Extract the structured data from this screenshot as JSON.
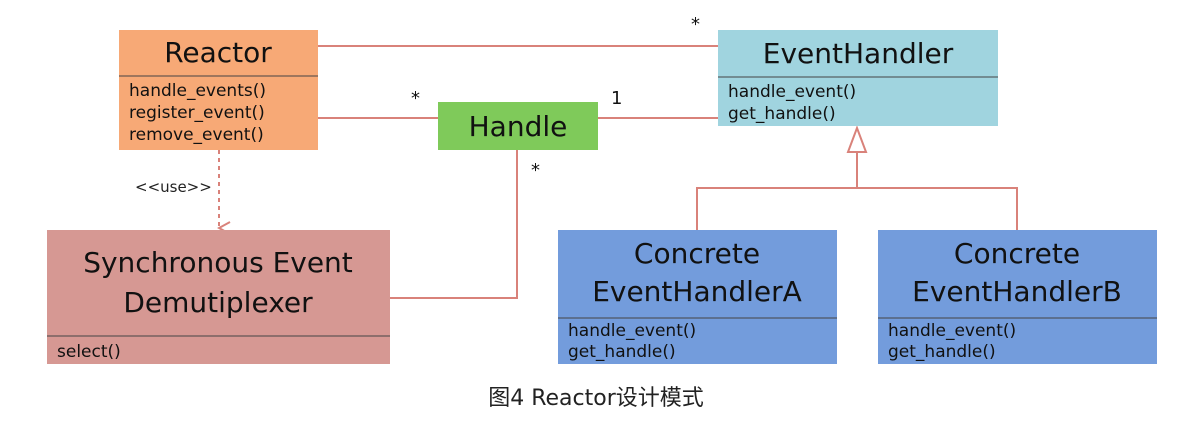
{
  "colors": {
    "reactor": "#f7a976",
    "event_handler": "#a0d4df",
    "handle": "#7fca5a",
    "demux": "#d69893",
    "concrete": "#739cdc",
    "connector": "#d9827a"
  },
  "reactor": {
    "title": "Reactor",
    "methods": [
      "handle_events()",
      "register_event()",
      "remove_event()"
    ]
  },
  "event_handler": {
    "title": "EventHandler",
    "methods": [
      "handle_event()",
      "get_handle()"
    ]
  },
  "handle": {
    "title": "Handle"
  },
  "demux": {
    "title_line1": "Synchronous Event",
    "title_line2": "Demutiplexer",
    "methods": [
      "select()"
    ]
  },
  "concrete_a": {
    "title_line1": "Concrete",
    "title_line2": "EventHandlerA",
    "methods": [
      "handle_event()",
      "get_handle()"
    ]
  },
  "concrete_b": {
    "title_line1": "Concrete",
    "title_line2": "EventHandlerB",
    "methods": [
      "handle_event()",
      "get_handle()"
    ]
  },
  "multiplicities": {
    "reactor_eventhandler": "*",
    "reactor_handle": "*",
    "handle_eventhandler": "1",
    "handle_demux": "*"
  },
  "stereotype": "<<use>>",
  "caption": "图4 Reactor设计模式"
}
